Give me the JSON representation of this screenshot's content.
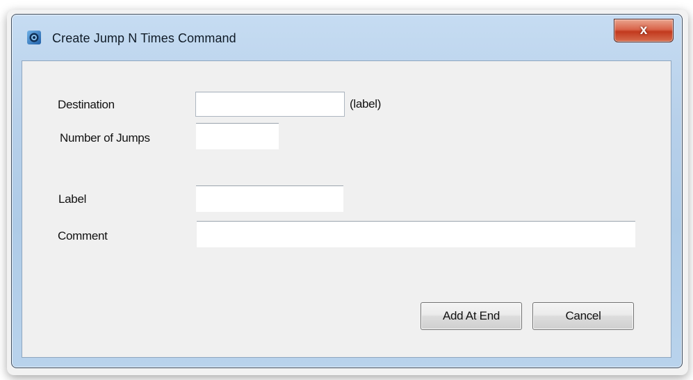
{
  "window": {
    "title": "Create Jump N Times Command",
    "close_label": "x"
  },
  "form": {
    "destination": {
      "label": "Destination",
      "value": "",
      "suffix": "(label)"
    },
    "number_of_jumps": {
      "label": "Number of Jumps",
      "value": ""
    },
    "label": {
      "label": "Label",
      "value": ""
    },
    "comment": {
      "label": "Comment",
      "value": ""
    }
  },
  "buttons": {
    "add_at_end": "Add At End",
    "cancel": "Cancel"
  },
  "icons": {
    "app": "app-icon",
    "close": "close-icon"
  },
  "colors": {
    "title_bar": "#b7d0ea",
    "close_button": "#c9452a",
    "client_background": "#f0f0f0"
  }
}
